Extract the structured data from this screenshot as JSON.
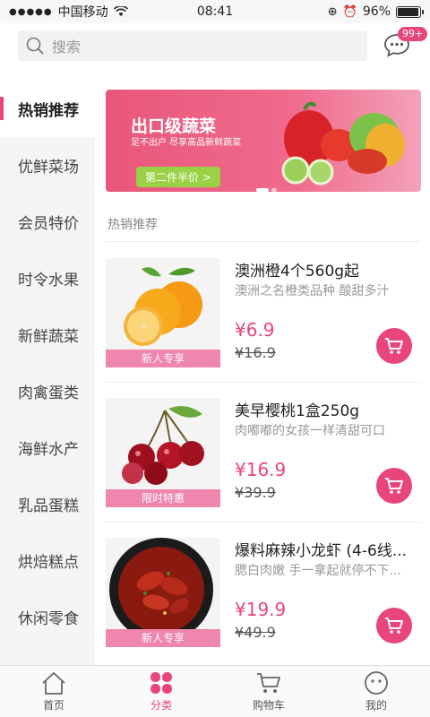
{
  "status": {
    "carrier": "中国移动",
    "time": "08:41",
    "battery": "96%",
    "battery_level": 0.96
  },
  "search": {
    "placeholder": "搜索",
    "badge": "99+"
  },
  "sidebar": {
    "items": [
      {
        "label": "热销推荐",
        "active": true
      },
      {
        "label": "优鲜菜场"
      },
      {
        "label": "会员特价"
      },
      {
        "label": "时令水果"
      },
      {
        "label": "新鲜蔬菜"
      },
      {
        "label": "肉禽蛋类"
      },
      {
        "label": "海鲜水产"
      },
      {
        "label": "乳品蛋糕"
      },
      {
        "label": "烘焙糕点"
      },
      {
        "label": "休闲零食"
      }
    ]
  },
  "banner": {
    "title": "出口级蔬菜",
    "subtitle": "足不出户 尽享高品新鲜蔬菜",
    "button": "第二件半价 >"
  },
  "section": {
    "title": "热销推荐"
  },
  "products": [
    {
      "name": "澳洲橙4个560g起",
      "desc": "澳洲之名橙类品种 酸甜多汁",
      "price": "¥6.9",
      "old_price": "¥16.9",
      "tag": "新人专享",
      "image": "orange"
    },
    {
      "name": "美早樱桃1盒250g",
      "desc": "肉嘟嘟的女孩一样清甜可口",
      "price": "¥16.9",
      "old_price": "¥39.9",
      "tag": "限时特惠",
      "image": "cherry"
    },
    {
      "name": "爆料麻辣小龙虾 (4-6线...",
      "desc": "腮白肉嫩 手一拿起就停不下...",
      "price": "¥19.9",
      "old_price": "¥49.9",
      "tag": "新人专享",
      "image": "crayfish"
    }
  ],
  "tabs": [
    {
      "label": "首页",
      "icon": "home-icon"
    },
    {
      "label": "分类",
      "icon": "category-icon",
      "active": true
    },
    {
      "label": "购物车",
      "icon": "cart-icon"
    },
    {
      "label": "我的",
      "icon": "profile-icon"
    }
  ],
  "colors": {
    "accent": "#e8457d",
    "tag": "#ef86ad",
    "banner_button": "#9bd245"
  }
}
